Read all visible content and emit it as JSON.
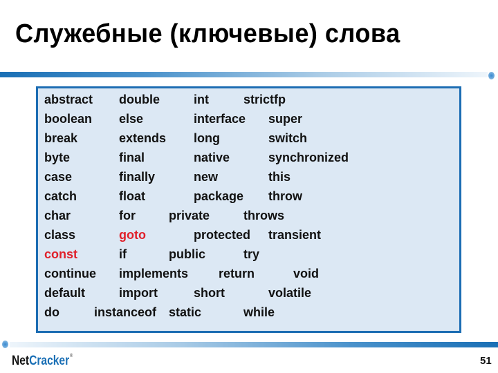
{
  "slide": {
    "title": "Служебные (ключевые) слова",
    "page_number": "51",
    "logo": {
      "part1": "Net",
      "part2": "Cracker",
      "registered": "®"
    },
    "colors": {
      "accent": "#1c6db3",
      "box_fill": "#dce8f4",
      "highlight": "#e0202a"
    }
  },
  "keywords": {
    "rows": [
      [
        "abstract",
        "double",
        "int",
        "strictfp"
      ],
      [
        "boolean",
        "else",
        "interface",
        "super"
      ],
      [
        "break",
        "extends",
        "long",
        "switch"
      ],
      [
        "byte",
        "final",
        "native",
        "synchronized"
      ],
      [
        "case",
        "finally",
        "new",
        "this"
      ],
      [
        "catch",
        "float",
        "package",
        "throw"
      ],
      [
        "char",
        "for",
        "private",
        "throws"
      ],
      [
        "class",
        "goto",
        "protected",
        "transient"
      ],
      [
        "const",
        "if",
        "public",
        "try"
      ],
      [
        "continue",
        "implements",
        "return",
        "void"
      ],
      [
        "default",
        "import",
        "short",
        "volatile"
      ],
      [
        "do",
        "instanceof",
        "static",
        "while"
      ]
    ],
    "highlighted": [
      "goto",
      "const"
    ]
  }
}
